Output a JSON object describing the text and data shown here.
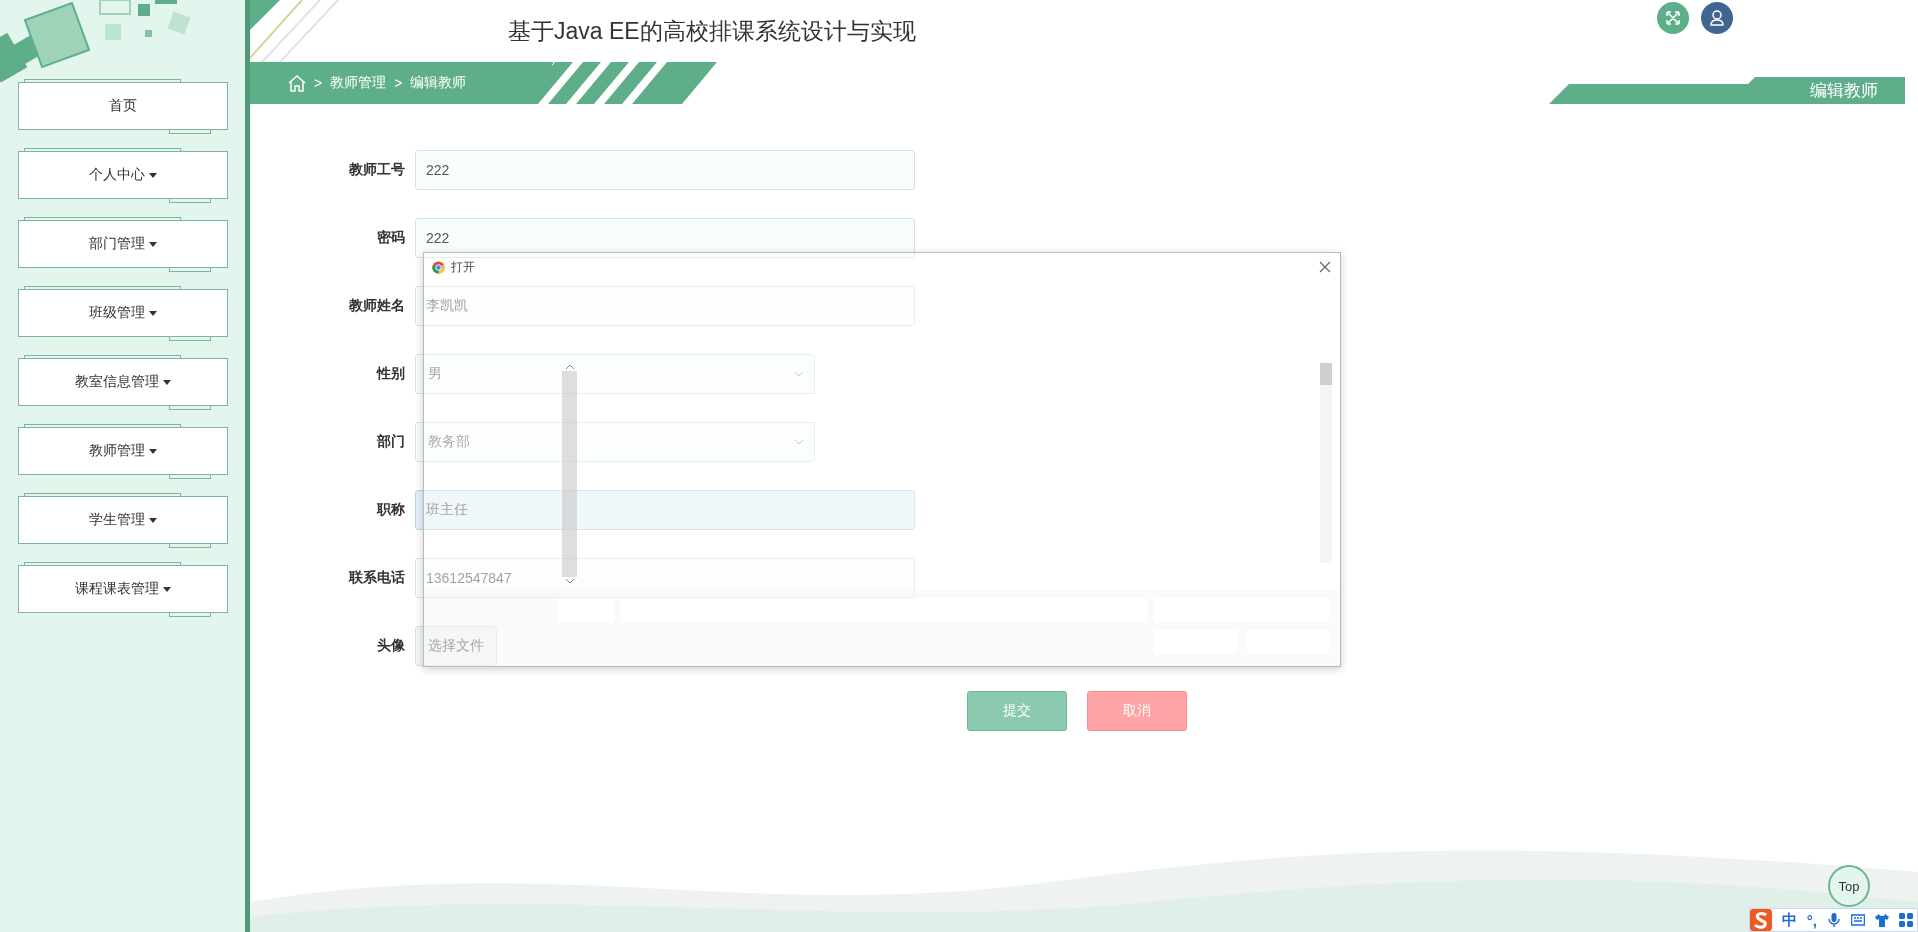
{
  "header": {
    "title": "基于Java EE的高校排课系统设计与实现"
  },
  "sidebar": {
    "items": [
      {
        "label": "首页",
        "has_menu": false
      },
      {
        "label": "个人中心",
        "has_menu": true
      },
      {
        "label": "部门管理",
        "has_menu": true
      },
      {
        "label": "班级管理",
        "has_menu": true
      },
      {
        "label": "教室信息管理",
        "has_menu": true
      },
      {
        "label": "教师管理",
        "has_menu": true
      },
      {
        "label": "学生管理",
        "has_menu": true
      },
      {
        "label": "课程课表管理",
        "has_menu": true
      }
    ]
  },
  "breadcrumb": [
    {
      "separator": ">",
      "label": "教师管理"
    },
    {
      "separator": ">",
      "label": "编辑教师"
    }
  ],
  "page_tab": "编辑教师",
  "form": {
    "fields": [
      {
        "label": "教师工号",
        "kind": "text",
        "value": "222",
        "highlighted": false
      },
      {
        "label": "密码",
        "kind": "text",
        "value": "222",
        "highlighted": false
      },
      {
        "label": "教师姓名",
        "kind": "text",
        "value": "李凯凯",
        "highlighted": false
      },
      {
        "label": "性别",
        "kind": "select",
        "value": "男"
      },
      {
        "label": "部门",
        "kind": "select",
        "value": "教务部"
      },
      {
        "label": "职称",
        "kind": "text",
        "value": "班主任",
        "highlighted": true
      },
      {
        "label": "联系电话",
        "kind": "text",
        "value": "13612547847",
        "highlighted": false
      },
      {
        "label": "头像",
        "kind": "file",
        "value": "选择文件"
      }
    ],
    "buttons": [
      {
        "label": "提交",
        "kind": "primary"
      },
      {
        "label": "取消",
        "kind": "danger"
      }
    ]
  },
  "dialog": {
    "title": "打开"
  },
  "back_to_top": "Top",
  "ime": {
    "items": [
      "中",
      "°,"
    ]
  }
}
